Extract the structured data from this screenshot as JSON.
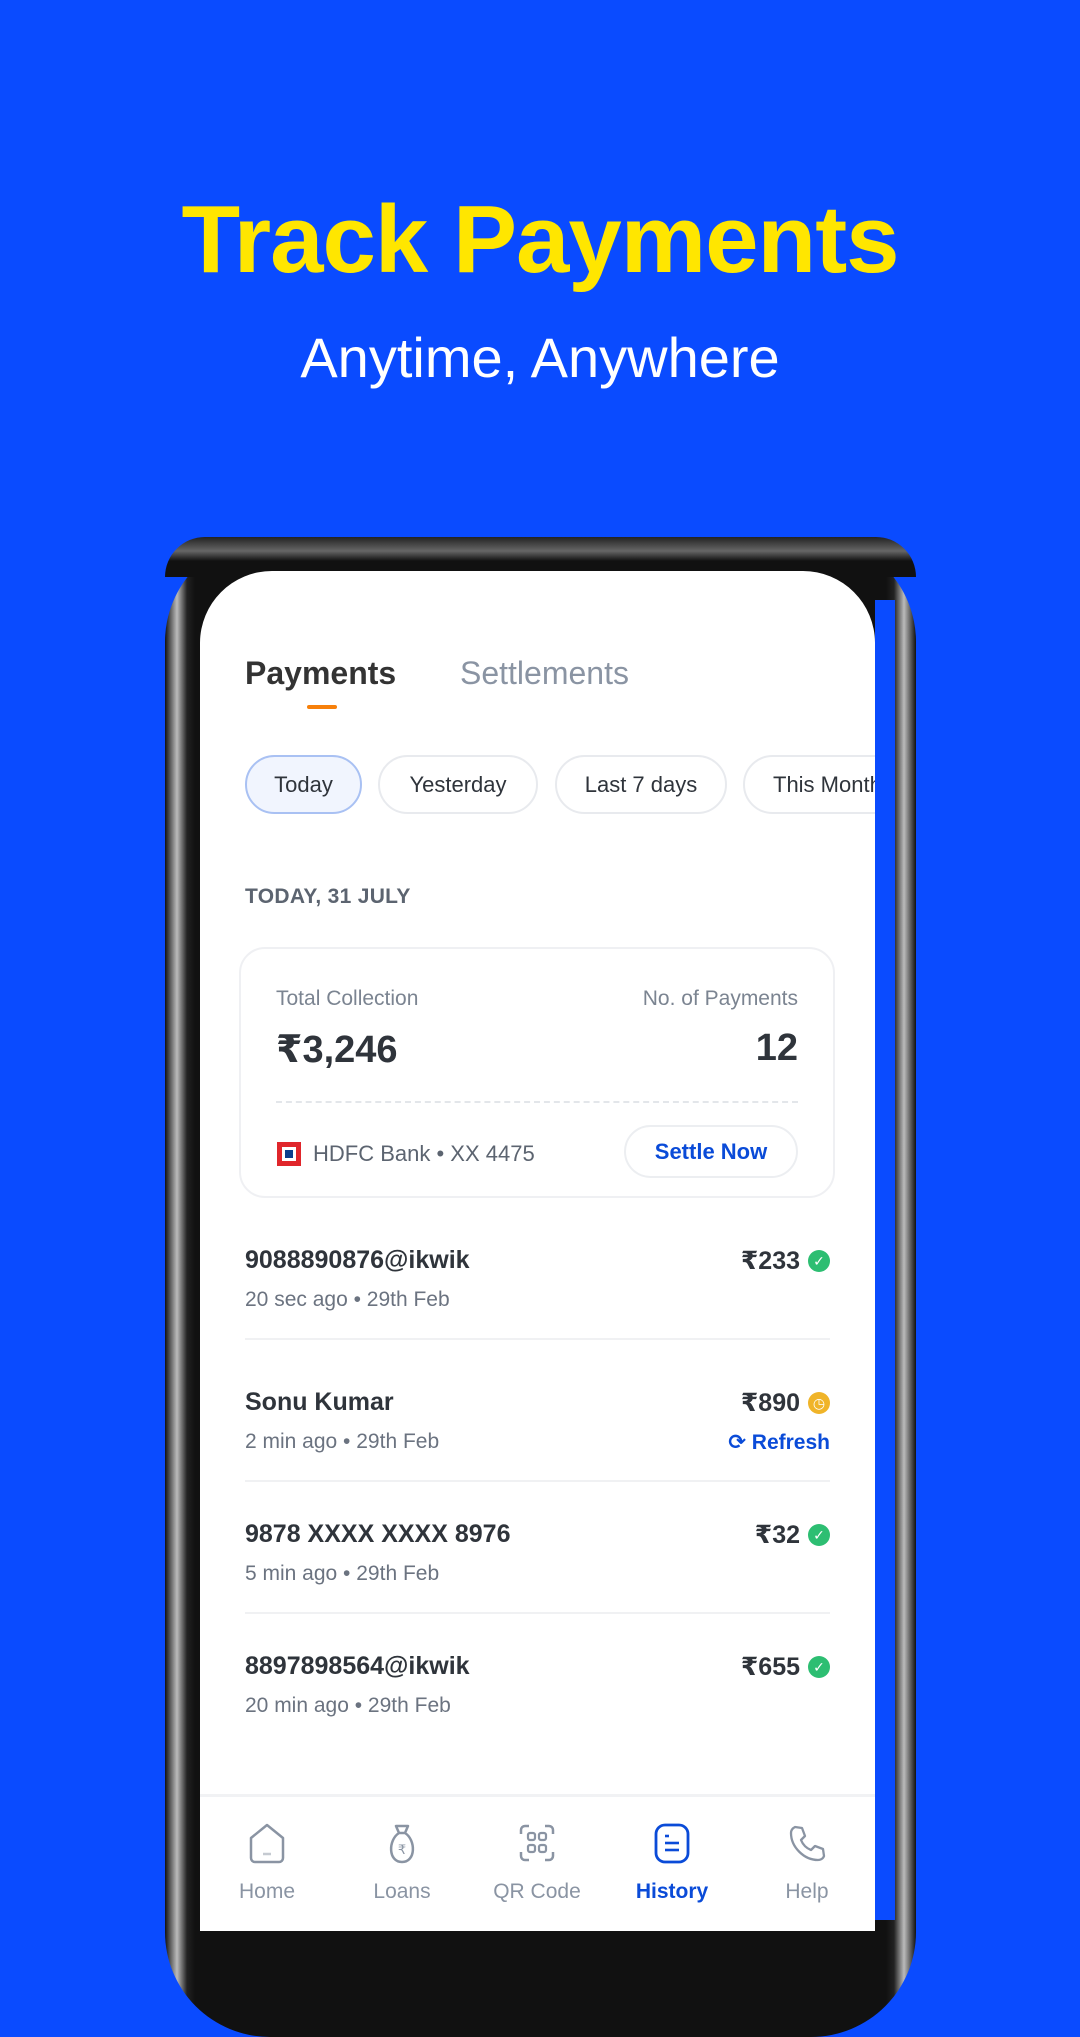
{
  "hero": {
    "title": "Track Payments",
    "subtitle": "Anytime, Anywhere"
  },
  "colors": {
    "background": "#0A4BFF",
    "title": "#FFE600",
    "accent": "#0A4BD8",
    "tab_underline": "#F7800A",
    "success": "#2DBE72",
    "pending": "#F0B429"
  },
  "tabs": [
    {
      "label": "Payments",
      "active": true
    },
    {
      "label": "Settlements",
      "active": false
    }
  ],
  "filters": [
    {
      "label": "Today",
      "selected": true
    },
    {
      "label": "Yesterday"
    },
    {
      "label": "Last 7 days"
    },
    {
      "label": "This Month"
    }
  ],
  "date_header": "TODAY, 31 JULY",
  "summary": {
    "total_label": "Total Collection",
    "total_value": "₹3,246",
    "count_label": "No. of Payments",
    "count_value": "12",
    "bank": "HDFC Bank • XX 4475",
    "settle_label": "Settle Now"
  },
  "payments": [
    {
      "name": "9088890876@ikwik",
      "time": "20 sec ago • 29th Feb",
      "amount": "₹233",
      "status": "success"
    },
    {
      "name": "Sonu Kumar",
      "time": "2 min ago • 29th Feb",
      "amount": "₹890",
      "status": "pending",
      "action": "Refresh"
    },
    {
      "name": "9878 XXXX XXXX 8976",
      "time": "5 min ago • 29th Feb",
      "amount": "₹32",
      "status": "success"
    },
    {
      "name": "8897898564@ikwik",
      "time": "20 min ago • 29th Feb",
      "amount": "₹655",
      "status": "success"
    }
  ],
  "nav": [
    {
      "label": "Home",
      "icon": "home-icon"
    },
    {
      "label": "Loans",
      "icon": "money-bag-icon"
    },
    {
      "label": "QR Code",
      "icon": "qr-code-icon"
    },
    {
      "label": "History",
      "icon": "history-icon",
      "active": true
    },
    {
      "label": "Help",
      "icon": "phone-icon"
    }
  ]
}
